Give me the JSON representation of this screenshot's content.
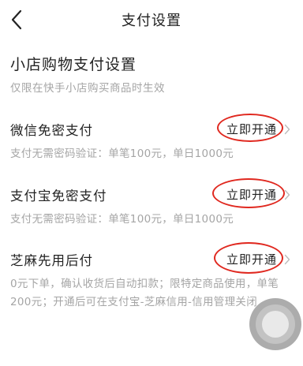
{
  "header": {
    "back_icon": "chevron-left-icon",
    "title": "支付设置"
  },
  "section": {
    "title": "小店购物支付设置",
    "subtitle": "仅限在快手小店购买商品时生效"
  },
  "items": [
    {
      "name": "微信免密支付",
      "action_label": "立即开通",
      "desc": "支付无需密码验证：单笔100元，单日1000元"
    },
    {
      "name": "支付宝免密支付",
      "action_label": "立即开通",
      "desc": "支付无需密码验证：单笔100元，单日1000元"
    },
    {
      "name": "芝麻先用后付",
      "action_label": "立即开通",
      "desc": "0元下单，确认收货后自动扣款；限特定商品使用，单笔200元；开通后可在支付宝-芝麻信用-信用管理关闭"
    }
  ],
  "colors": {
    "annotation_circle": "#e0281f",
    "primary_text": "#222222",
    "secondary_text": "#a5a5a5"
  }
}
